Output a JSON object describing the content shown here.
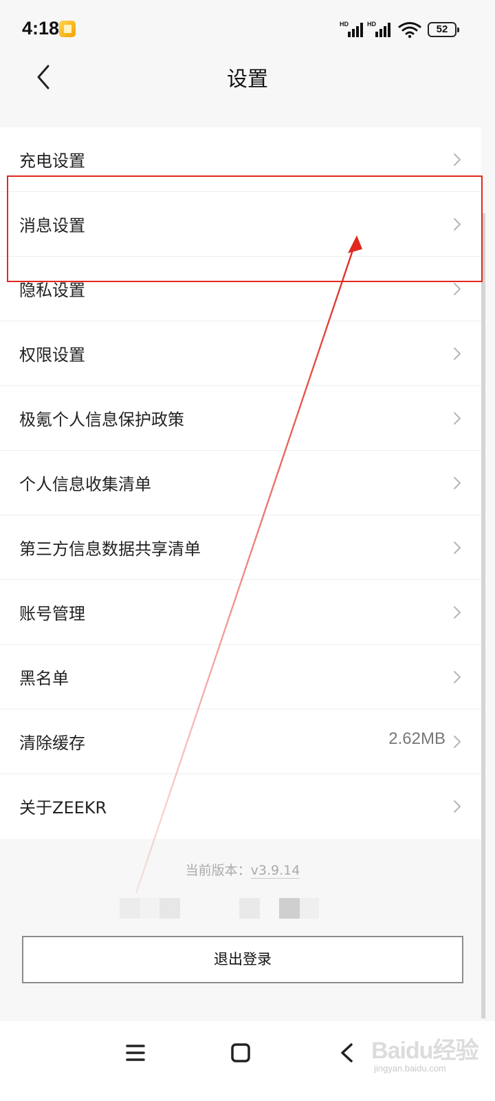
{
  "status_bar": {
    "time": "4:18",
    "network_label_1": "HD",
    "network_label_2": "HD",
    "battery": "52",
    "icons": [
      "notification-icon",
      "signal-icon",
      "wifi-icon",
      "battery-icon"
    ]
  },
  "header": {
    "title": "设置",
    "back_icon": "chevron-left-icon"
  },
  "settings": {
    "items": [
      {
        "label": "充电设置",
        "value": ""
      },
      {
        "label": "消息设置",
        "value": ""
      },
      {
        "label": "隐私设置",
        "value": ""
      },
      {
        "label": "权限设置",
        "value": ""
      },
      {
        "label": "极氪个人信息保护政策",
        "value": ""
      },
      {
        "label": "个人信息收集清单",
        "value": ""
      },
      {
        "label": "第三方信息数据共享清单",
        "value": ""
      },
      {
        "label": "账号管理",
        "value": ""
      },
      {
        "label": "黑名单",
        "value": ""
      },
      {
        "label": "清除缓存",
        "value": "2.62MB"
      },
      {
        "label": "关于ZEEKR",
        "value": ""
      }
    ]
  },
  "footer": {
    "version_label": "当前版本：",
    "version": "v3.9.14",
    "logout_label": "退出登录"
  },
  "system_nav": {
    "icons": [
      "menu-icon",
      "home-icon",
      "back-icon"
    ]
  },
  "watermark": {
    "text": "Baidu经验",
    "subtext": "jingyan.baidu.com"
  },
  "colors": {
    "annotation": "#e0281c",
    "background": "#f7f7f7",
    "list_background": "#ffffff"
  }
}
